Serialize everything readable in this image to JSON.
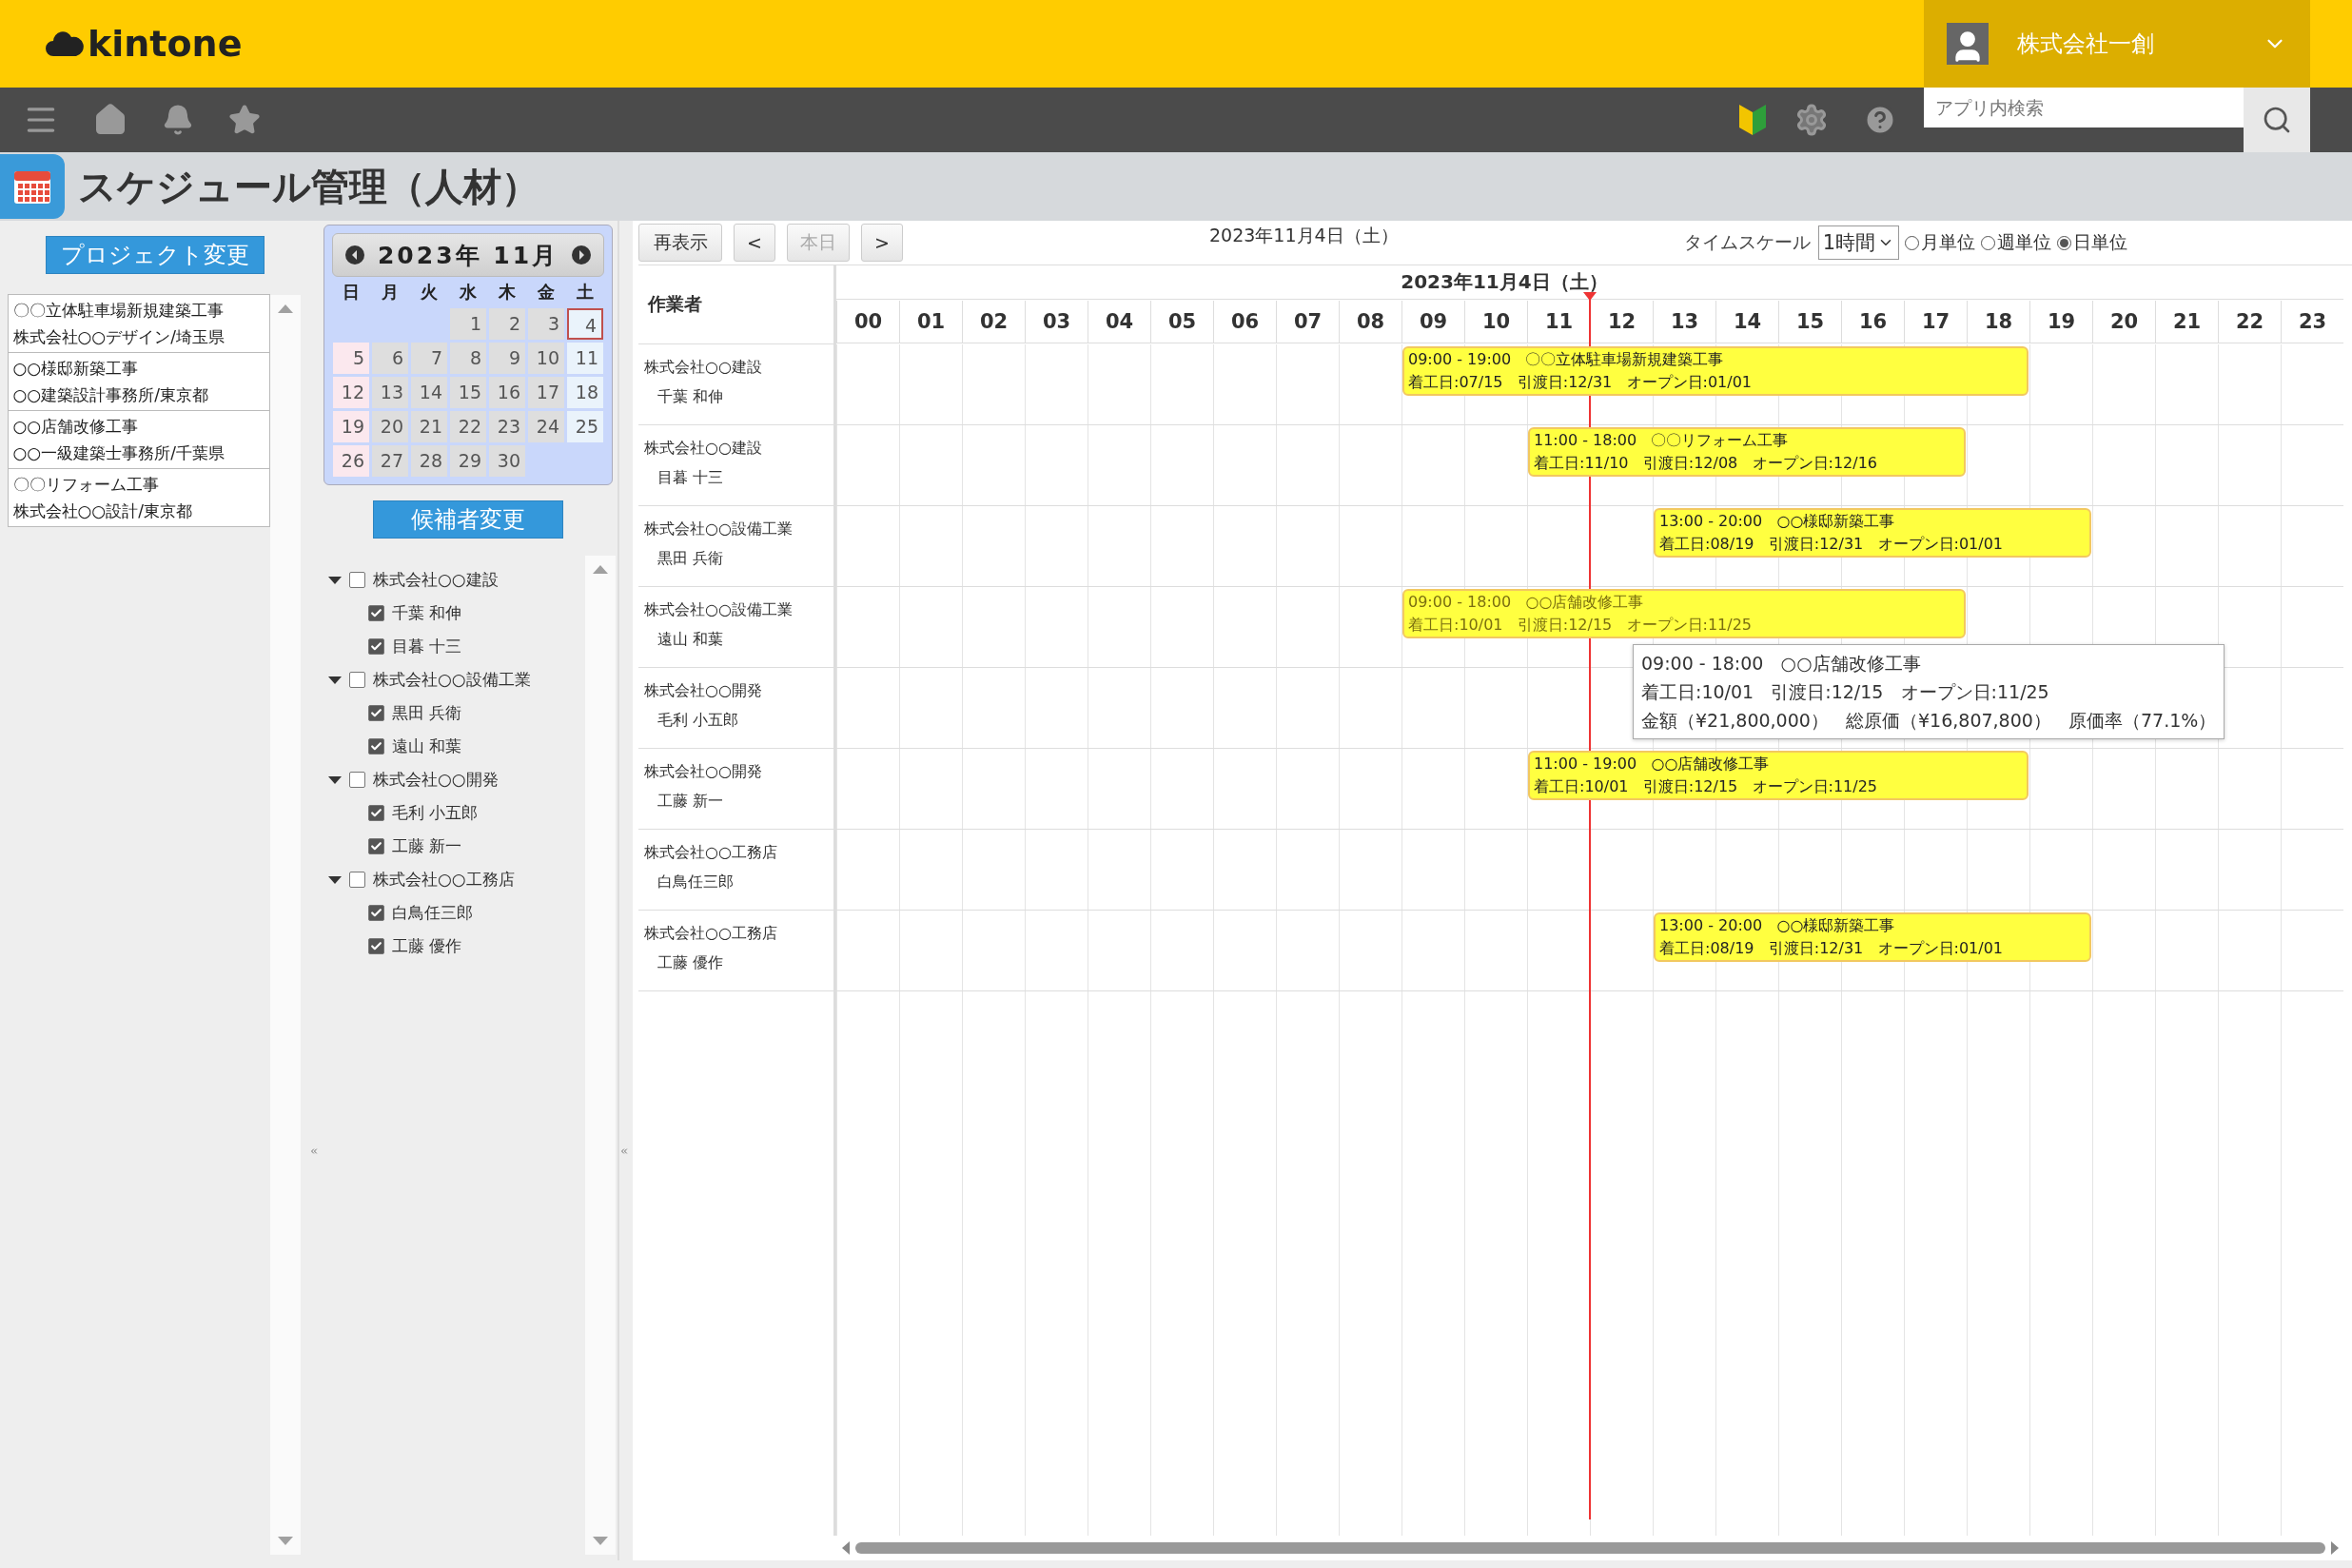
{
  "app": {
    "logo": "kintone",
    "user": "株式会社一創",
    "search_placeholder": "アプリ内検索",
    "title": "スケジュール管理（人材）"
  },
  "projects": {
    "button": "プロジェクト変更",
    "items": [
      {
        "name": "〇〇立体駐車場新規建築工事",
        "client": "株式会社○○デザイン/埼玉県"
      },
      {
        "name": "○○様邸新築工事",
        "client": "○○建築設計事務所/東京都"
      },
      {
        "name": "○○店舗改修工事",
        "client": "○○一級建築士事務所/千葉県"
      },
      {
        "name": "〇〇リフォーム工事",
        "client": "株式会社○○設計/東京都"
      }
    ]
  },
  "calendar": {
    "title": "2023年 11月",
    "weekdays": [
      "日",
      "月",
      "火",
      "水",
      "木",
      "金",
      "土"
    ],
    "weeks": [
      {
        "days": [
          {
            "day": "1",
            "selected": false
          },
          {
            "day": "2",
            "selected": false
          },
          {
            "day": "3",
            "selected": false
          },
          {
            "day": "4",
            "selected": true
          }
        ]
      },
      {
        "days": [
          {
            "day": "5",
            "selected": false
          },
          {
            "day": "6",
            "selected": false
          },
          {
            "day": "7",
            "selected": false
          },
          {
            "day": "8",
            "selected": false
          },
          {
            "day": "9",
            "selected": false
          },
          {
            "day": "10",
            "selected": false
          },
          {
            "day": "11",
            "selected": false
          }
        ]
      },
      {
        "days": [
          {
            "day": "12",
            "selected": false
          },
          {
            "day": "13",
            "selected": false
          },
          {
            "day": "14",
            "selected": false
          },
          {
            "day": "15",
            "selected": false
          },
          {
            "day": "16",
            "selected": false
          },
          {
            "day": "17",
            "selected": false
          },
          {
            "day": "18",
            "selected": false
          }
        ]
      },
      {
        "days": [
          {
            "day": "19",
            "selected": false
          },
          {
            "day": "20",
            "selected": false
          },
          {
            "day": "21",
            "selected": false
          },
          {
            "day": "22",
            "selected": false
          },
          {
            "day": "23",
            "selected": false
          },
          {
            "day": "24",
            "selected": false
          },
          {
            "day": "25",
            "selected": false
          }
        ]
      },
      {
        "days": [
          {
            "day": "26",
            "selected": false
          },
          {
            "day": "27",
            "selected": false
          },
          {
            "day": "28",
            "selected": false
          },
          {
            "day": "29",
            "selected": false
          },
          {
            "day": "30",
            "selected": false
          }
        ]
      }
    ]
  },
  "candidates": {
    "button": "候補者変更",
    "groups": [
      {
        "name": "株式会社○○建設",
        "expanded": true,
        "checked": false,
        "children": [
          {
            "name": "千葉 和伸",
            "checked": true
          },
          {
            "name": "目暮 十三",
            "checked": true
          }
        ]
      },
      {
        "name": "株式会社○○設備工業",
        "expanded": true,
        "checked": false,
        "children": [
          {
            "name": "黒田 兵衛",
            "checked": true
          },
          {
            "name": "遠山 和葉",
            "checked": true
          }
        ]
      },
      {
        "name": "株式会社○○開発",
        "expanded": true,
        "checked": false,
        "children": [
          {
            "name": "毛利 小五郎",
            "checked": true
          },
          {
            "name": "工藤 新一",
            "checked": true
          }
        ]
      },
      {
        "name": "株式会社○○工務店",
        "expanded": true,
        "checked": false,
        "children": [
          {
            "name": "白鳥任三郎",
            "checked": true
          },
          {
            "name": "工藤 優作",
            "checked": true
          }
        ]
      }
    ]
  },
  "schedule": {
    "toolbar": {
      "refresh": "再表示",
      "prev": "<",
      "today": {
        "label": "本日",
        "disabled": true
      },
      "next": ">",
      "date": "2023年11月4日（土）",
      "timescale_label": "タイムスケール",
      "timescale": "1時間",
      "views": [
        {
          "label": "月単位",
          "selected": false
        },
        {
          "label": "週単位",
          "selected": false
        },
        {
          "label": "日単位",
          "selected": true
        }
      ]
    },
    "grid": {
      "worker_header": "作業者",
      "date": "2023年11月4日（土）",
      "hours": [
        "00",
        "01",
        "02",
        "03",
        "04",
        "05",
        "06",
        "07",
        "08",
        "09",
        "10",
        "11",
        "12",
        "13",
        "14",
        "15",
        "16",
        "17",
        "18",
        "19",
        "20",
        "21",
        "22",
        "23"
      ],
      "now": {
        "level": 0.5
      }
    },
    "rows": [
      {
        "company": "株式会社○○建設",
        "person": "千葉 和伸",
        "events": [
          {
            "time": "09:00 - 19:00",
            "title": "〇〇立体駐車場新規建築工事",
            "details": "着工日:07/15   引渡日:12/31   オープン日:01/01",
            "hovered": false
          }
        ]
      },
      {
        "company": "株式会社○○建設",
        "person": "目暮 十三",
        "events": [
          {
            "time": "11:00 - 18:00",
            "title": "〇〇リフォーム工事",
            "details": "着工日:11/10   引渡日:12/08   オープン日:12/16",
            "hovered": false
          }
        ]
      },
      {
        "company": "株式会社○○設備工業",
        "person": "黒田 兵衛",
        "events": [
          {
            "time": "13:00 - 20:00",
            "title": "○○様邸新築工事",
            "details": "着工日:08/19   引渡日:12/31   オープン日:01/01",
            "hovered": false
          }
        ]
      },
      {
        "company": "株式会社○○設備工業",
        "person": "遠山 和葉",
        "events": [
          {
            "time": "09:00 - 18:00",
            "title": "○○店舗改修工事",
            "details": "着工日:10/01   引渡日:12/15   オープン日:11/25",
            "hovered": true,
            "tooltip": [
              "09:00 - 18:00   ○○店舗改修工事",
              "着工日:10/01   引渡日:12/15   オープン日:11/25",
              "金額（¥21,800,000）   総原価（¥16,807,800）   原価率（77.1%）"
            ]
          }
        ]
      },
      {
        "company": "株式会社○○開発",
        "person": "毛利 小五郎",
        "events": []
      },
      {
        "company": "株式会社○○開発",
        "person": "工藤 新一",
        "events": [
          {
            "time": "11:00 - 19:00",
            "title": "○○店舗改修工事",
            "details": "着工日:10/01   引渡日:12/15   オープン日:11/25",
            "hovered": false
          }
        ]
      },
      {
        "company": "株式会社○○工務店",
        "person": "白鳥任三郎",
        "events": []
      },
      {
        "company": "株式会社○○工務店",
        "person": "工藤 優作",
        "events": [
          {
            "time": "13:00 - 20:00",
            "title": "○○様邸新築工事",
            "details": "着工日:08/19   引渡日:12/31   オープン日:01/01",
            "hovered": false
          }
        ]
      }
    ]
  }
}
